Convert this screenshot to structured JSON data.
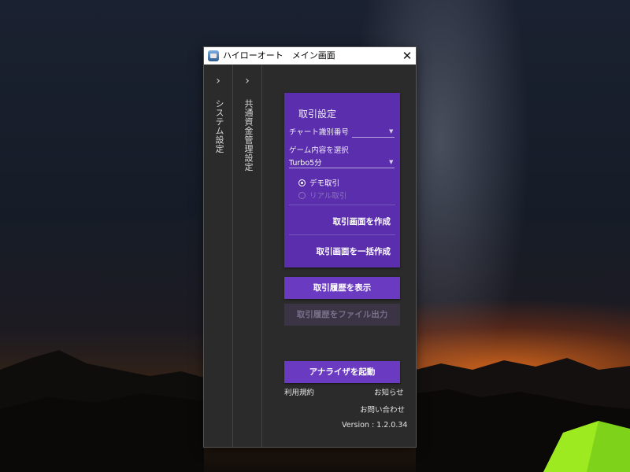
{
  "window": {
    "title": "ハイローオート　メイン画面",
    "close_glyph": "✕"
  },
  "rail": {
    "chevron": "›",
    "system_settings": "システム設定",
    "funds_settings": "共通資金管理設定"
  },
  "trade_card": {
    "title": "取引設定",
    "chart_id_label": "チャート識別番号",
    "chart_id_value": "",
    "game_label": "ゲーム内容を選択",
    "game_value": "Turbo5分",
    "demo_label": "デモ取引",
    "real_label": "リアル取引",
    "selected_mode": "デモ取引",
    "create_button": "取引画面を作成",
    "bulk_create_button": "取引画面を一括作成"
  },
  "actions": {
    "show_history": "取引履歴を表示",
    "export_history": "取引履歴をファイル出力",
    "launch_analyzer": "アナライザを起動"
  },
  "footer": {
    "terms": "利用規約",
    "news": "お知らせ",
    "contact": "お問い合わせ",
    "version": "Version : 1.2.0.34"
  },
  "colors": {
    "accent": "#6a3bc0",
    "card": "#5b2eae",
    "panel": "#2b2b2b"
  },
  "icons": {
    "app": "app-logo-icon",
    "close": "close-icon",
    "rail_expand": "chevron-right-icon",
    "dropdown": "dropdown-caret-icon"
  }
}
